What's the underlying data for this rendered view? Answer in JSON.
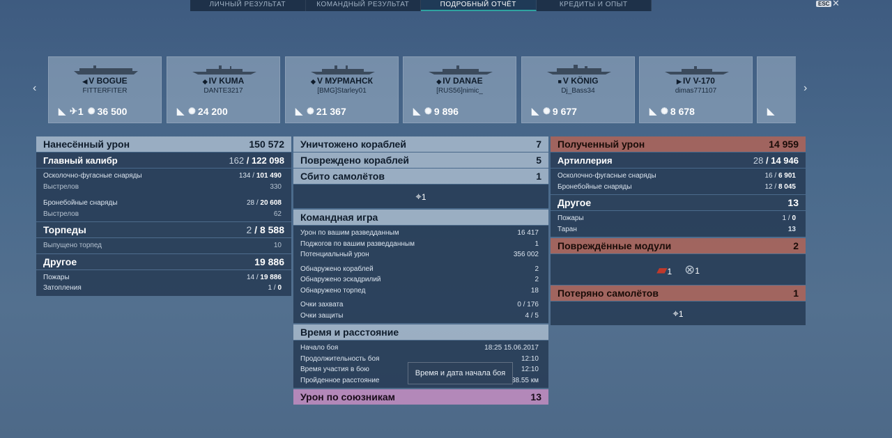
{
  "tabs": [
    {
      "label": "ЛИЧНЫЙ РЕЗУЛЬТАТ"
    },
    {
      "label": "КОМАНДНЫЙ РЕЗУЛЬТАТ"
    },
    {
      "label": "ПОДРОБНЫЙ ОТЧЁТ"
    },
    {
      "label": "КРЕДИТЫ И ОПЫТ"
    }
  ],
  "esc_label": "ESC",
  "ships": [
    {
      "name": "V BOGUE",
      "player": "FITTERFITER",
      "planes": "1",
      "damage": "36 500"
    },
    {
      "name": "IV KUMA",
      "player": "DANTE3217",
      "damage": "24 200"
    },
    {
      "name": "V МУРМАНСК",
      "player": "[BMG]Starley01",
      "damage": "21 367"
    },
    {
      "name": "IV DANAE",
      "player": "[RUS56]nimic_",
      "damage": "9 896"
    },
    {
      "name": "V KÖNIG",
      "player": "Dj_Bass34",
      "damage": "9 677"
    },
    {
      "name": "IV V-170",
      "player": "dimas771107",
      "damage": "8 678"
    }
  ],
  "dealt": {
    "title": "Нанесённый урон",
    "total": "150 572",
    "main": {
      "label": "Главный калибр",
      "hits": "162",
      "value": "122 098"
    },
    "he": {
      "label": "Осколочно-фугасные снаряды",
      "hits": "134",
      "value": "101 490",
      "shots_label": "Выстрелов",
      "shots": "330"
    },
    "ap": {
      "label": "Бронебойные снаряды",
      "hits": "28",
      "value": "20 608",
      "shots_label": "Выстрелов",
      "shots": "62"
    },
    "torp": {
      "label": "Торпеды",
      "hits": "2",
      "value": "8 588",
      "launched_label": "Выпущено торпед",
      "launched": "10"
    },
    "other": {
      "label": "Другое",
      "value": "19 886",
      "fires_label": "Пожары",
      "fires_hits": "14",
      "fires": "19 886",
      "flood_label": "Затопления",
      "flood_hits": "1",
      "flood": "0"
    }
  },
  "middle": {
    "destroyed_label": "Уничтожено кораблей",
    "destroyed": "7",
    "damaged_label": "Повреждено кораблей",
    "damaged": "5",
    "planes_label": "Сбито самолётов",
    "planes": "1",
    "planes_icon_count": "1",
    "team": {
      "title": "Командная игра",
      "rows": [
        {
          "label": "Урон по вашим разведданным",
          "value": "16 417"
        },
        {
          "label": "Поджогов по вашим разведданным",
          "value": "1"
        },
        {
          "label": "Потенциальный урон",
          "value": "356 002"
        },
        {
          "label": "Обнаружено кораблей",
          "value": "2"
        },
        {
          "label": "Обнаружено эскадрилий",
          "value": "2"
        },
        {
          "label": "Обнаружено торпед",
          "value": "18"
        },
        {
          "label": "Очки захвата",
          "value": "0 / 176"
        },
        {
          "label": "Очки защиты",
          "value": "4 / 5"
        }
      ]
    },
    "time": {
      "title": "Время и расстояние",
      "rows": [
        {
          "label": "Начало боя",
          "value": "18:25  15.06.2017"
        },
        {
          "label": "Продолжительность боя",
          "value": "12:10"
        },
        {
          "label": "Время участия в бою",
          "value": "12:10"
        },
        {
          "label": "Пройденное расстояние",
          "value": "38.55 км"
        }
      ],
      "tooltip": "Время и дата начала боя"
    },
    "allies_label": "Урон по союзникам",
    "allies": "13"
  },
  "received": {
    "title": "Полученный урон",
    "total": "14 959",
    "artillery": {
      "label": "Артиллерия",
      "hits": "28",
      "value": "14 946"
    },
    "he": {
      "label": "Осколочно-фугасные снаряды",
      "hits": "16",
      "value": "6 901"
    },
    "ap": {
      "label": "Бронебойные снаряды",
      "hits": "12",
      "value": "8 045"
    },
    "other": {
      "label": "Другое",
      "value": "13",
      "fires_label": "Пожары",
      "fires_hits": "1",
      "fires": "0",
      "ram_label": "Таран",
      "ram": "13"
    },
    "modules": {
      "label": "Повреждённые модули",
      "value": "2",
      "m1": "1",
      "m2": "1"
    },
    "lost_planes": {
      "label": "Потеряно самолётов",
      "value": "1",
      "icon_count": "1"
    }
  }
}
